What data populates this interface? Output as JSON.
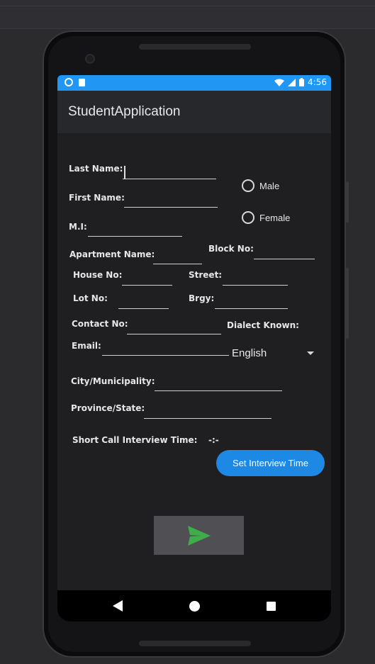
{
  "status_bar": {
    "time": "4:56"
  },
  "app_bar": {
    "title": "StudentApplication"
  },
  "form": {
    "last_name_label": "Last Name:",
    "first_name_label": "First Name:",
    "mi_label": "M.I:",
    "gender_options": [
      "Male",
      "Female"
    ],
    "apartment_label": "Apartment Name:",
    "block_label": "Block No:",
    "house_label": "House No:",
    "street_label": "Street:",
    "lot_label": "Lot No:",
    "brgy_label": "Brgy:",
    "contact_label": "Contact No:",
    "dialect_label": "Dialect Known:",
    "email_label": "Email:",
    "dialect_value": "English",
    "city_label": "City/Municipality:",
    "province_label": "Province/State:",
    "interview_label": "Short Call Interview Time:",
    "interview_value": "-:-",
    "set_time_button": "Set Interview Time"
  },
  "colors": {
    "status_bar": "#2196f3",
    "app_bar": "#26282c",
    "screen_bg": "#1f1f22",
    "accent_button": "#1e88e5",
    "send_icon": "#3fae4a"
  },
  "icons": [
    "send-icon",
    "back-icon",
    "home-icon",
    "recents-icon",
    "wifi-icon",
    "signal-icon",
    "battery-icon"
  ]
}
